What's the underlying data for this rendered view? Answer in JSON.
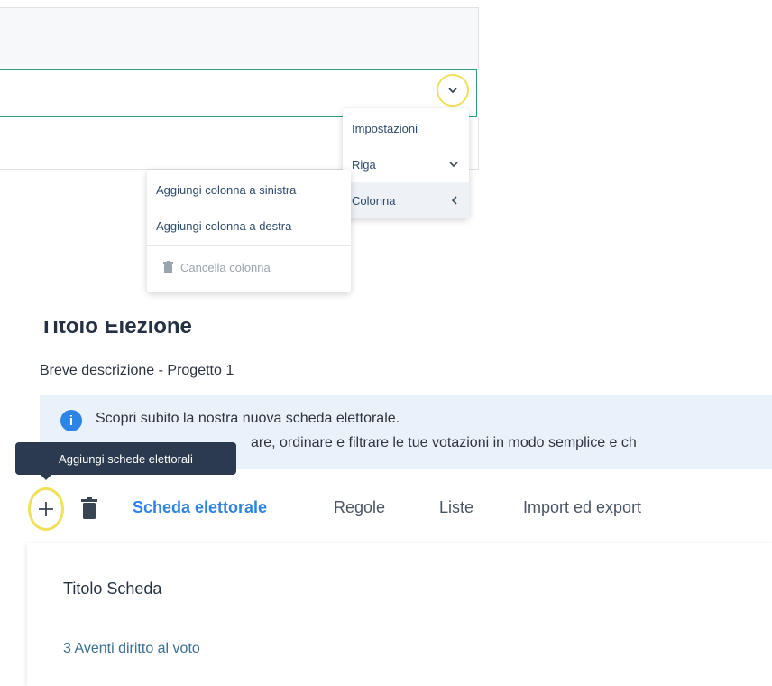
{
  "table": {
    "row_menu_icon": "chevron-down-icon"
  },
  "context_menu": {
    "items": [
      {
        "label": "Impostazioni",
        "icon": ""
      },
      {
        "label": "Riga",
        "icon": "chevron-down-icon",
        "glyph": "⌄"
      },
      {
        "label": "Colonna",
        "icon": "chevron-left-icon",
        "glyph": "‹"
      }
    ]
  },
  "column_menu": {
    "items": [
      {
        "label": "Aggiungi colonna a sinistra"
      },
      {
        "label": "Aggiungi colonna a destra"
      },
      {
        "label": "Cancella colonna",
        "icon": "trash-icon",
        "disabled": true
      }
    ]
  },
  "election": {
    "title": "Titolo Elezione",
    "description": "Breve descrizione - Progetto 1"
  },
  "info_banner": {
    "line1": "Scopri subito la nostra nuova scheda elettorale.",
    "line2": "are, ordinare e filtrare le tue votazioni in modo semplice e ch",
    "icon": "info-icon"
  },
  "tooltip": {
    "text": "Aggiungi schede elettorali"
  },
  "toolbar": {
    "add_icon": "plus-icon",
    "delete_icon": "trash-icon",
    "tabs": [
      {
        "label": "Scheda elettorale",
        "active": true
      },
      {
        "label": "Regole",
        "active": false
      },
      {
        "label": "Liste",
        "active": false
      },
      {
        "label": "Import ed export",
        "active": false
      }
    ]
  },
  "card": {
    "title": "Titolo Scheda",
    "voters": "3 Aventi diritto al voto"
  },
  "colors": {
    "accent": "#2e84e4",
    "highlight_ring": "#f1e05a",
    "tooltip_bg": "#2b3a4e",
    "active_row_border": "#2f9a7e"
  }
}
